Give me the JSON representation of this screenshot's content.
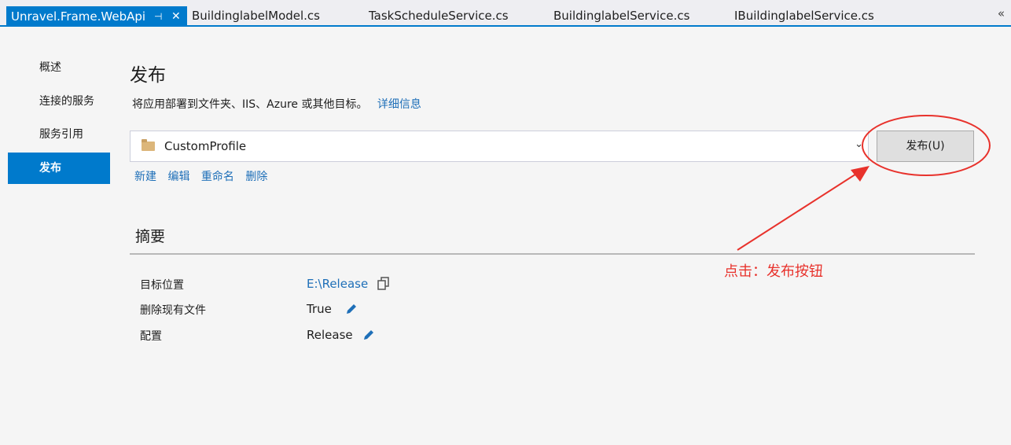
{
  "tabs": {
    "active": "Unravel.Frame.WebApi",
    "pin_glyph": "⊣",
    "close_glyph": "✕",
    "others": [
      "BuildinglabelModel.cs",
      "TaskScheduleService.cs",
      "BuildinglabelService.cs",
      "IBuildinglabelService.cs"
    ],
    "overflow_glyph": "«"
  },
  "sidebar": {
    "items": [
      {
        "label": "概述"
      },
      {
        "label": "连接的服务"
      },
      {
        "label": "服务引用"
      },
      {
        "label": "发布",
        "selected": true
      }
    ]
  },
  "main": {
    "title": "发布",
    "description": "将应用部署到文件夹、IIS、Azure 或其他目标。",
    "details_link": "详细信息",
    "profile": {
      "selected": "CustomProfile",
      "icon": "folder-icon",
      "publish_button": "发布(U)"
    },
    "actions": [
      "新建",
      "编辑",
      "重命名",
      "删除"
    ],
    "summary": {
      "title": "摘要",
      "rows": [
        {
          "label": "目标位置",
          "value": "E:\\Release",
          "value_is_link": true,
          "icon": "copy-icon"
        },
        {
          "label": "删除现有文件",
          "value": "True",
          "icon": "edit-icon"
        },
        {
          "label": "配置",
          "value": "Release",
          "icon": "edit-icon"
        }
      ]
    }
  },
  "annotation": {
    "text": "点击：发布按钮",
    "color": "#e8322c"
  },
  "colors": {
    "accent": "#007acc",
    "link": "#1e6fb8"
  }
}
